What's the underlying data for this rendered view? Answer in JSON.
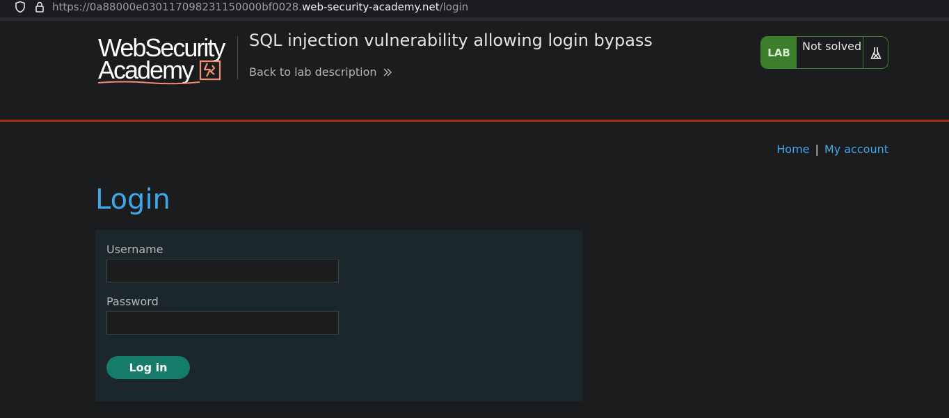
{
  "browser": {
    "url_prefix": "https://0a88000e030117098231150000bf0028.",
    "url_host": "web-security-academy.net",
    "url_path": "/login"
  },
  "header": {
    "logo_line1": "WebSecurity",
    "logo_line2": "Academy",
    "lab_title": "SQL injection vulnerability allowing login bypass",
    "back_link": "Back to lab description",
    "lab_tag": "LAB",
    "status": "Not solved"
  },
  "nav": {
    "home": "Home",
    "separator": "|",
    "my_account": "My account"
  },
  "page": {
    "title": "Login"
  },
  "form": {
    "username_label": "Username",
    "username_value": "",
    "password_label": "Password",
    "password_value": "",
    "submit_label": "Log in"
  },
  "colors": {
    "accent_blue": "#3ea7e6",
    "header_rule": "#a83212",
    "lab_green": "#3d7e2c",
    "button_teal": "#157c69",
    "panel_bg": "#1c272b",
    "logo_orange": "#f28f6e"
  }
}
